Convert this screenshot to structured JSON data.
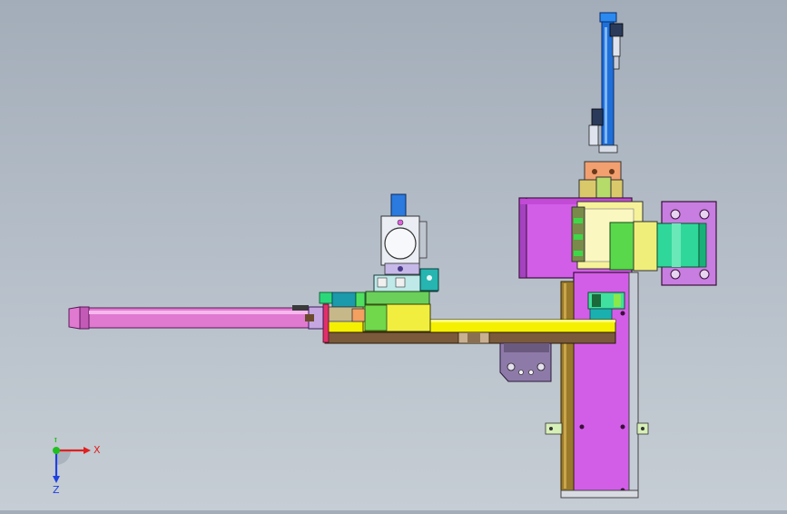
{
  "viewport": {
    "background_top": "#a3adb9",
    "background_bottom": "#c6cdd4"
  },
  "model": {
    "parts": [
      {
        "name": "lifting-cylinder",
        "color": "#1f6fd8"
      },
      {
        "name": "main-column-plate",
        "color": "#d25ee8"
      },
      {
        "name": "mounting-bracket",
        "color": "#c77ee0"
      },
      {
        "name": "support-arm",
        "color": "#f4f000"
      },
      {
        "name": "base-rail",
        "color": "#7a5a3a"
      },
      {
        "name": "horizontal-cylinder",
        "color": "#e07ad0"
      },
      {
        "name": "vertical-rail",
        "color": "#9a7a2a"
      },
      {
        "name": "motor-coupling",
        "color": "#2fd89a"
      },
      {
        "name": "gripper-block",
        "color": "#eaeef4"
      },
      {
        "name": "gear-housing",
        "color": "#f6f29a"
      },
      {
        "name": "valve-module",
        "color": "#26b5b0"
      },
      {
        "name": "lower-clamp",
        "color": "#8e7aa8"
      }
    ]
  },
  "triad": {
    "x_label": "X",
    "y_label": "Y",
    "z_label": "Z",
    "x_color": "#e02020",
    "y_color": "#20c020",
    "z_color": "#2040e0"
  }
}
